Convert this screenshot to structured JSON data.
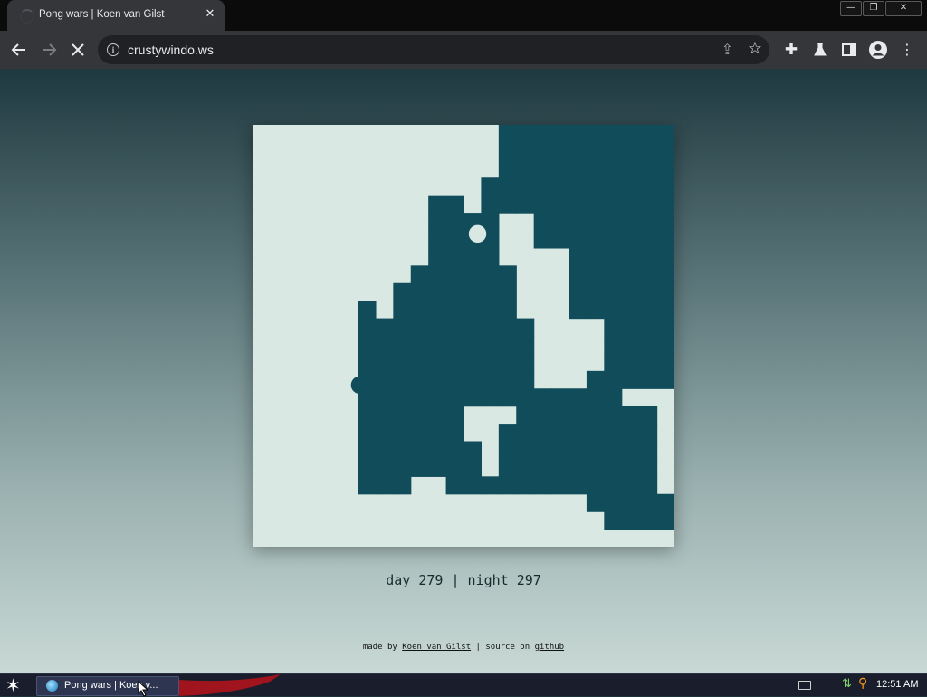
{
  "tab": {
    "title": "Pong wars | Koen van Gilst",
    "close_icon": "close-icon"
  },
  "window_controls": {
    "minimize": "minimize-icon",
    "restore": "restore-icon",
    "close": "close-icon"
  },
  "toolbar": {
    "url": "crustywindo.ws"
  },
  "game": {
    "colors": {
      "day": "#d9e8e3",
      "night": "#114c5a"
    },
    "grid_cols": 24,
    "grid_rows": 24,
    "night_cells": [
      "..............##########",
      "..............##########",
      "..............##########",
      ".............###########",
      "..........##.###########",
      "..........####..########",
      "..........####..########",
      "..........####....######",
      ".........######...######",
      "........#######...######",
      "......#.#######...######",
      "......##########....####",
      "......##########....####",
      "......##########....####",
      "......##########...#####",
      "......###############...",
      "......######...########.",
      "......######..#########.",
      "......#######.#########.",
      "......#######.#########.",
      "......###..############.",
      "...................#####",
      "....................####",
      "........................"
    ],
    "balls": [
      {
        "team": "day",
        "col": 12.8,
        "row": 6.2
      },
      {
        "team": "night",
        "col": 6.1,
        "row": 14.8
      }
    ]
  },
  "score": {
    "day_label": "day",
    "day_value": "279",
    "sep": "|",
    "night_label": "night",
    "night_value": "297"
  },
  "footer": {
    "made_by": "made by",
    "author": "Koen van Gilst",
    "sep": "|",
    "source_on": "source on",
    "github": "github"
  },
  "taskbar": {
    "item_label": "Pong wars | Koen v...",
    "clock": "12:51 AM"
  }
}
